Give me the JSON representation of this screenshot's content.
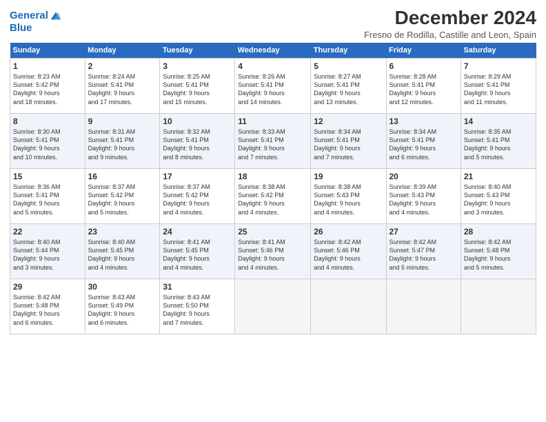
{
  "header": {
    "logo_line1": "General",
    "logo_line2": "Blue",
    "month_title": "December 2024",
    "location": "Fresno de Rodilla, Castille and Leon, Spain"
  },
  "days_of_week": [
    "Sunday",
    "Monday",
    "Tuesday",
    "Wednesday",
    "Thursday",
    "Friday",
    "Saturday"
  ],
  "weeks": [
    [
      {
        "day": "1",
        "lines": [
          "Sunrise: 8:23 AM",
          "Sunset: 5:42 PM",
          "Daylight: 9 hours",
          "and 18 minutes."
        ]
      },
      {
        "day": "2",
        "lines": [
          "Sunrise: 8:24 AM",
          "Sunset: 5:41 PM",
          "Daylight: 9 hours",
          "and 17 minutes."
        ]
      },
      {
        "day": "3",
        "lines": [
          "Sunrise: 8:25 AM",
          "Sunset: 5:41 PM",
          "Daylight: 9 hours",
          "and 15 minutes."
        ]
      },
      {
        "day": "4",
        "lines": [
          "Sunrise: 8:26 AM",
          "Sunset: 5:41 PM",
          "Daylight: 9 hours",
          "and 14 minutes."
        ]
      },
      {
        "day": "5",
        "lines": [
          "Sunrise: 8:27 AM",
          "Sunset: 5:41 PM",
          "Daylight: 9 hours",
          "and 13 minutes."
        ]
      },
      {
        "day": "6",
        "lines": [
          "Sunrise: 8:28 AM",
          "Sunset: 5:41 PM",
          "Daylight: 9 hours",
          "and 12 minutes."
        ]
      },
      {
        "day": "7",
        "lines": [
          "Sunrise: 8:29 AM",
          "Sunset: 5:41 PM",
          "Daylight: 9 hours",
          "and 11 minutes."
        ]
      }
    ],
    [
      {
        "day": "8",
        "lines": [
          "Sunrise: 8:30 AM",
          "Sunset: 5:41 PM",
          "Daylight: 9 hours",
          "and 10 minutes."
        ]
      },
      {
        "day": "9",
        "lines": [
          "Sunrise: 8:31 AM",
          "Sunset: 5:41 PM",
          "Daylight: 9 hours",
          "and 9 minutes."
        ]
      },
      {
        "day": "10",
        "lines": [
          "Sunrise: 8:32 AM",
          "Sunset: 5:41 PM",
          "Daylight: 9 hours",
          "and 8 minutes."
        ]
      },
      {
        "day": "11",
        "lines": [
          "Sunrise: 8:33 AM",
          "Sunset: 5:41 PM",
          "Daylight: 9 hours",
          "and 7 minutes."
        ]
      },
      {
        "day": "12",
        "lines": [
          "Sunrise: 8:34 AM",
          "Sunset: 5:41 PM",
          "Daylight: 9 hours",
          "and 7 minutes."
        ]
      },
      {
        "day": "13",
        "lines": [
          "Sunrise: 8:34 AM",
          "Sunset: 5:41 PM",
          "Daylight: 9 hours",
          "and 6 minutes."
        ]
      },
      {
        "day": "14",
        "lines": [
          "Sunrise: 8:35 AM",
          "Sunset: 5:41 PM",
          "Daylight: 9 hours",
          "and 5 minutes."
        ]
      }
    ],
    [
      {
        "day": "15",
        "lines": [
          "Sunrise: 8:36 AM",
          "Sunset: 5:41 PM",
          "Daylight: 9 hours",
          "and 5 minutes."
        ]
      },
      {
        "day": "16",
        "lines": [
          "Sunrise: 8:37 AM",
          "Sunset: 5:42 PM",
          "Daylight: 9 hours",
          "and 5 minutes."
        ]
      },
      {
        "day": "17",
        "lines": [
          "Sunrise: 8:37 AM",
          "Sunset: 5:42 PM",
          "Daylight: 9 hours",
          "and 4 minutes."
        ]
      },
      {
        "day": "18",
        "lines": [
          "Sunrise: 8:38 AM",
          "Sunset: 5:42 PM",
          "Daylight: 9 hours",
          "and 4 minutes."
        ]
      },
      {
        "day": "19",
        "lines": [
          "Sunrise: 8:38 AM",
          "Sunset: 5:43 PM",
          "Daylight: 9 hours",
          "and 4 minutes."
        ]
      },
      {
        "day": "20",
        "lines": [
          "Sunrise: 8:39 AM",
          "Sunset: 5:43 PM",
          "Daylight: 9 hours",
          "and 4 minutes."
        ]
      },
      {
        "day": "21",
        "lines": [
          "Sunrise: 8:40 AM",
          "Sunset: 5:43 PM",
          "Daylight: 9 hours",
          "and 3 minutes."
        ]
      }
    ],
    [
      {
        "day": "22",
        "lines": [
          "Sunrise: 8:40 AM",
          "Sunset: 5:44 PM",
          "Daylight: 9 hours",
          "and 3 minutes."
        ]
      },
      {
        "day": "23",
        "lines": [
          "Sunrise: 8:40 AM",
          "Sunset: 5:45 PM",
          "Daylight: 9 hours",
          "and 4 minutes."
        ]
      },
      {
        "day": "24",
        "lines": [
          "Sunrise: 8:41 AM",
          "Sunset: 5:45 PM",
          "Daylight: 9 hours",
          "and 4 minutes."
        ]
      },
      {
        "day": "25",
        "lines": [
          "Sunrise: 8:41 AM",
          "Sunset: 5:46 PM",
          "Daylight: 9 hours",
          "and 4 minutes."
        ]
      },
      {
        "day": "26",
        "lines": [
          "Sunrise: 8:42 AM",
          "Sunset: 5:46 PM",
          "Daylight: 9 hours",
          "and 4 minutes."
        ]
      },
      {
        "day": "27",
        "lines": [
          "Sunrise: 8:42 AM",
          "Sunset: 5:47 PM",
          "Daylight: 9 hours",
          "and 5 minutes."
        ]
      },
      {
        "day": "28",
        "lines": [
          "Sunrise: 8:42 AM",
          "Sunset: 5:48 PM",
          "Daylight: 9 hours",
          "and 5 minutes."
        ]
      }
    ],
    [
      {
        "day": "29",
        "lines": [
          "Sunrise: 8:42 AM",
          "Sunset: 5:48 PM",
          "Daylight: 9 hours",
          "and 6 minutes."
        ]
      },
      {
        "day": "30",
        "lines": [
          "Sunrise: 8:43 AM",
          "Sunset: 5:49 PM",
          "Daylight: 9 hours",
          "and 6 minutes."
        ]
      },
      {
        "day": "31",
        "lines": [
          "Sunrise: 8:43 AM",
          "Sunset: 5:50 PM",
          "Daylight: 9 hours",
          "and 7 minutes."
        ]
      },
      {
        "day": "",
        "lines": []
      },
      {
        "day": "",
        "lines": []
      },
      {
        "day": "",
        "lines": []
      },
      {
        "day": "",
        "lines": []
      }
    ]
  ]
}
